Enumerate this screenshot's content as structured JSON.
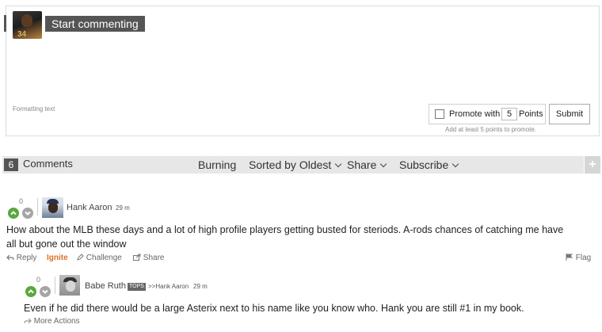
{
  "composer": {
    "start_label": "Start commenting",
    "formatting_label": "Formatting text",
    "promote_label": "Promote with",
    "promote_points": "5",
    "points_label": "Points",
    "submit_label": "Submit",
    "hint": "Add at least 5 points to promote."
  },
  "toolbar": {
    "count": "6",
    "comments_label": "Comments",
    "burning": "Burning",
    "sorted": "Sorted by Oldest",
    "share": "Share",
    "subscribe": "Subscribe",
    "add": "+"
  },
  "comments": [
    {
      "score": "0",
      "author": "Hank Aaron",
      "time": "29 m",
      "text_line1": "How about the MLB these days and a lot of high profile players getting busted for steriods. A-rods chances of catching me have",
      "text_line2": "all but gone out the window",
      "reply": "Reply",
      "ignite": "Ignite",
      "challenge": "Challenge",
      "share": "Share",
      "flag": "Flag"
    },
    {
      "score": "0",
      "author": "Babe Ruth",
      "badge": "TOPS",
      "reply_to": ">>Hank Aaron",
      "time": "29 m",
      "text": "Even if he did there would be a large Asterix next to his name like you know who. Hank you are still #1 in my book.",
      "more_actions": "More Actions"
    }
  ],
  "colors": {
    "upvote": "#56a93e",
    "downvote": "#a5a5a5",
    "ignite": "#e07026",
    "dark_label": "#555555"
  }
}
